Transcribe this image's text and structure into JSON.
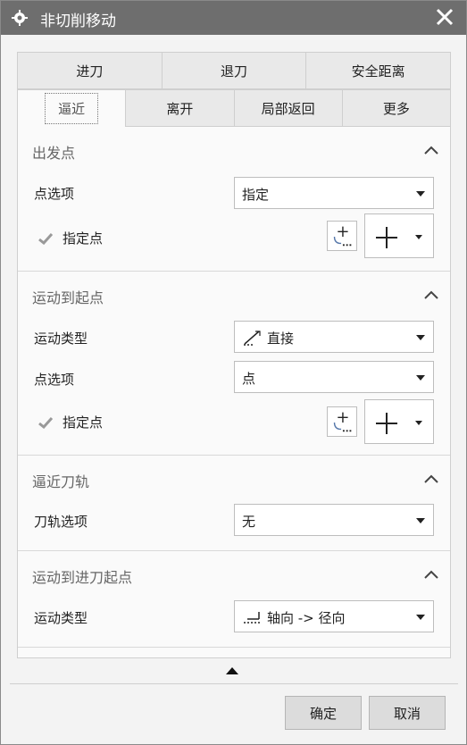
{
  "window": {
    "title": "非切削移动"
  },
  "tabs_row1": [
    {
      "label": "进刀"
    },
    {
      "label": "退刀"
    },
    {
      "label": "安全距离"
    }
  ],
  "tabs_row2": [
    {
      "label": "逼近"
    },
    {
      "label": "离开"
    },
    {
      "label": "局部返回"
    },
    {
      "label": "更多"
    }
  ],
  "active_tab": "逼近",
  "sections": {
    "departure": {
      "title": "出发点",
      "point_option_label": "点选项",
      "point_option_value": "指定",
      "specify_point_label": "指定点"
    },
    "move_to_start": {
      "title": "运动到起点",
      "motion_type_label": "运动类型",
      "motion_type_value": "直接",
      "point_option_label": "点选项",
      "point_option_value": "点",
      "specify_point_label": "指定点"
    },
    "approach_path": {
      "title": "逼近刀轨",
      "path_option_label": "刀轨选项",
      "path_option_value": "无"
    },
    "move_to_engage": {
      "title": "运动到进刀起点",
      "motion_type_label": "运动类型",
      "motion_type_value": "轴向 -> 径向"
    }
  },
  "buttons": {
    "ok": "确定",
    "cancel": "取消"
  },
  "icons": {
    "title": "gear-icon",
    "close": "close-icon",
    "collapse": "chevron-up-icon",
    "check": "checkmark-icon",
    "point_constructor": "point-dialog-icon",
    "point_type": "plus-icon",
    "motion_direct": "direct-motion-icon",
    "motion_axial_radial": "axial-radial-icon",
    "expand": "triangle-up-icon"
  },
  "colors": {
    "titlebar": "#6e6e6e",
    "check": "#999999"
  }
}
